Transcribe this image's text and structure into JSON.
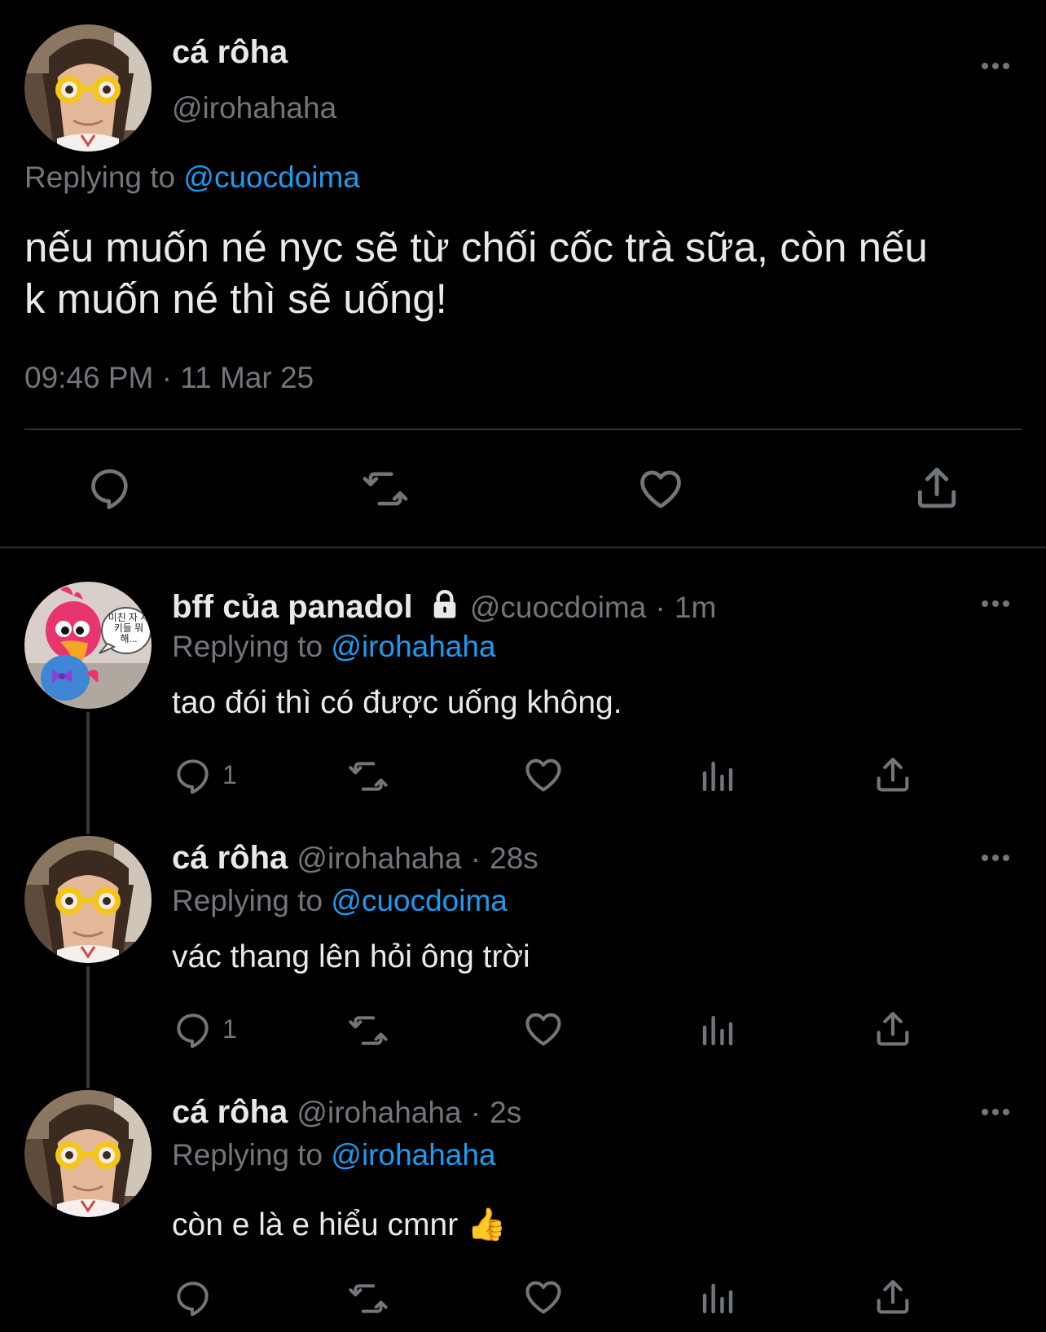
{
  "main_tweet": {
    "display_name": "cá rôha",
    "handle": "@irohahaha",
    "replying_prefix": "Replying to",
    "replying_to": "@cuocdoima",
    "text_line1": "nếu muốn né nyc sẽ từ chối cốc trà sữa, còn nếu",
    "text_line2": "k muốn né thì sẽ uống!",
    "time": "09:46 PM",
    "date": "11 Mar 25"
  },
  "replies": [
    {
      "display_name": "bff của panadol",
      "handle": "@cuocdoima",
      "age": "1m",
      "replying_prefix": "Replying to",
      "replying_to": "@irohahaha",
      "text": "tao đói thì có được uống không.",
      "reply_count": "1",
      "protected": true,
      "avatar_bubble_text": "미친 자 새키들 뭐해..."
    },
    {
      "display_name": "cá rôha",
      "handle": "@irohahaha",
      "age": "28s",
      "replying_prefix": "Replying to",
      "replying_to": "@cuocdoima",
      "text": "vác thang lên hỏi ông trời",
      "reply_count": "1"
    },
    {
      "display_name": "cá rôha",
      "handle": "@irohahaha",
      "age": "2s",
      "replying_prefix": "Replying to",
      "replying_to": "@irohahaha",
      "text": "còn e là e hiểu cmnr",
      "emoji": "👍",
      "reply_count": ""
    }
  ],
  "separator": "·",
  "colors": {
    "background": "#000000",
    "text": "#e7e9ea",
    "muted": "#71767b",
    "link": "#1d9bf0",
    "divider": "#2f3336"
  },
  "icons": [
    "more-icon",
    "reply-icon",
    "retweet-icon",
    "like-icon",
    "share-icon",
    "views-icon",
    "lock-icon"
  ]
}
